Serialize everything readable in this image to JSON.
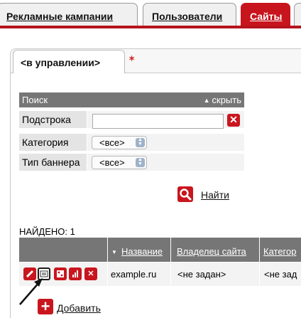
{
  "top_tabs": [
    {
      "label": "Рекламные кампании"
    },
    {
      "label": "Пользователи"
    },
    {
      "label": "Сайты",
      "active": true
    },
    {
      "label": ""
    }
  ],
  "sub_tab": {
    "label": "<в управлении>"
  },
  "search": {
    "header": "Поиск",
    "hide_label": "скрыть",
    "fields": {
      "substring_label": "Подстрока",
      "substring_value": "",
      "category_label": "Категория",
      "category_value": "<все>",
      "banner_type_label": "Тип баннера",
      "banner_type_value": "<все>"
    },
    "find_label": "Найти"
  },
  "results": {
    "found_label": "НАЙДЕНО: 1",
    "columns": [
      "Название",
      "Владелец сайта",
      "Категор"
    ],
    "rows": [
      {
        "name": "example.ru",
        "owner": "<не задан>",
        "category": "<не зад"
      }
    ]
  },
  "add_label": "Добавить",
  "colors": {
    "accent": "#c9161e",
    "header_bg": "#767676"
  }
}
